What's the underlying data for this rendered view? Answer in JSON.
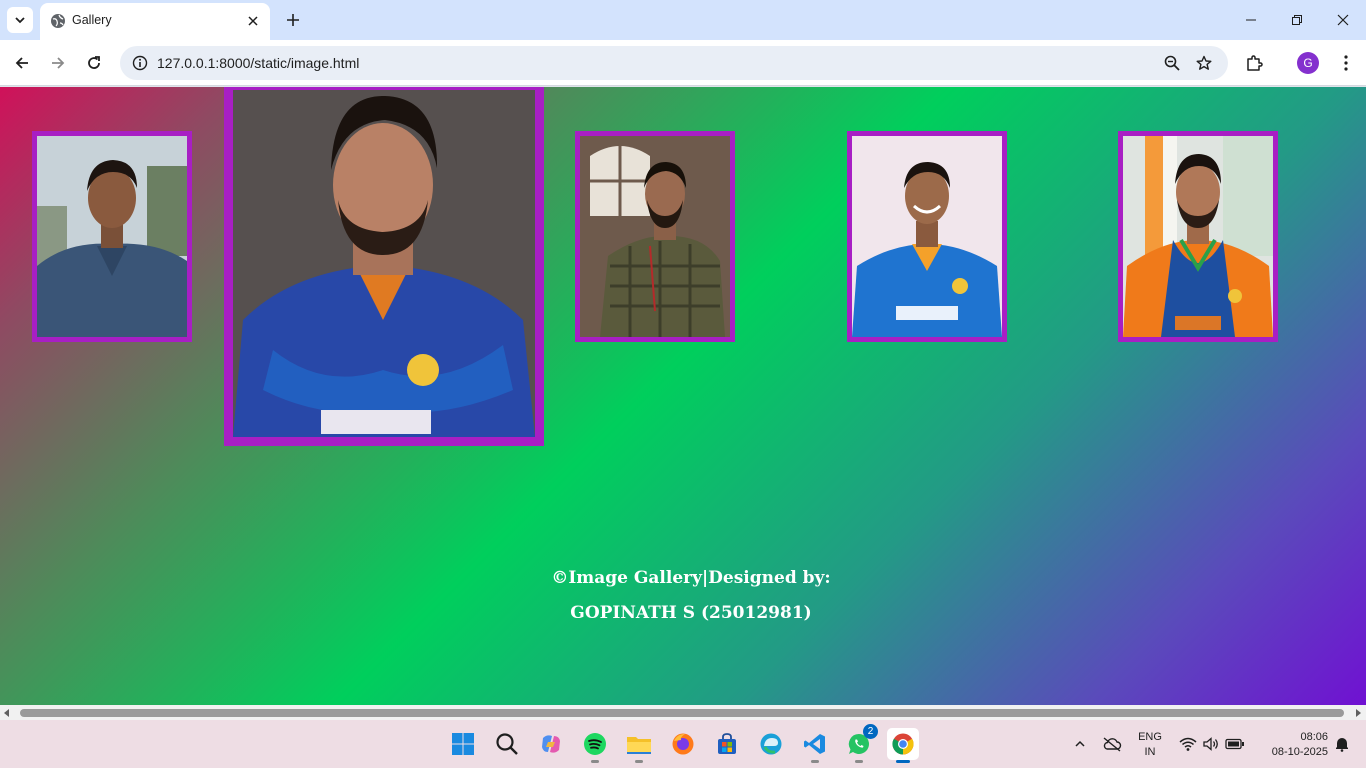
{
  "browser": {
    "tab_title": "Gallery",
    "url": "127.0.0.1:8000/static/image.html",
    "profile_initial": "G"
  },
  "gallery": {
    "photos": [
      {
        "description_icon": "person-photo"
      },
      {
        "description_icon": "cricketer-photo"
      },
      {
        "description_icon": "person-photo"
      },
      {
        "description_icon": "cricketer-photo"
      },
      {
        "description_icon": "cricketer-photo"
      }
    ],
    "footer_line1": "©Image Gallery|Designed by:",
    "footer_line2": "GOPINATH S (25012981)",
    "colors": {
      "frame": "#a81fc4",
      "gradient_start": "#d0115a",
      "gradient_mid": "#00cf5c",
      "gradient_end": "#7011d2"
    }
  },
  "taskbar": {
    "whatsapp_badge": "2",
    "language_line1": "ENG",
    "language_line2": "IN",
    "time": "08:06",
    "date": "08-10-2025"
  }
}
